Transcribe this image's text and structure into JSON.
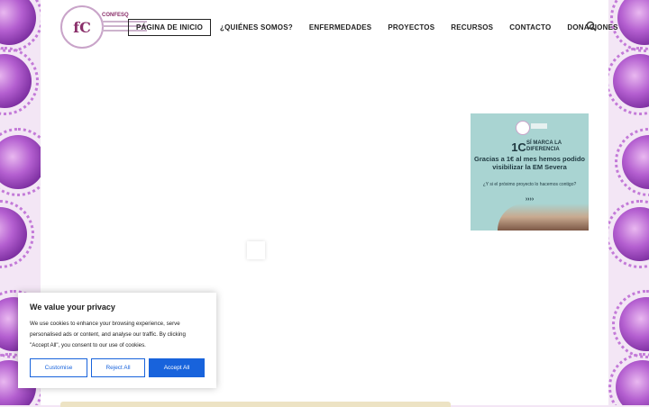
{
  "header": {
    "logo_mark": "fC",
    "logo_title": "CONFESQ",
    "nav": [
      {
        "label": "PÁGINA DE INICIO",
        "active": true
      },
      {
        "label": "¿QUIÉNES SOMOS?",
        "active": false
      },
      {
        "label": "ENFERMEDADES",
        "active": false
      },
      {
        "label": "PROYECTOS",
        "active": false
      },
      {
        "label": "RECURSOS",
        "active": false
      },
      {
        "label": "CONTACTO",
        "active": false
      },
      {
        "label": "DONACIONES",
        "active": false
      }
    ],
    "search_icon": "search-icon"
  },
  "ad": {
    "big": "1C",
    "small": "SÍ MARCA LA DIFERENCIA",
    "main": "Gracias a 1€ al mes hemos podido visibilizar la EM Severa",
    "sub": "¿Y si el próximo proyecto lo hacemos contigo?",
    "arrows": "››››",
    "bg_color": "#a9d4d2"
  },
  "cookie": {
    "title": "We value your privacy",
    "body": "We use cookies to enhance your browsing experience, serve personalised ads or content, and analyse our traffic. By clicking \"Accept All\", you consent to our use of cookies.",
    "customise": "Customise",
    "reject": "Reject All",
    "accept": "Accept All",
    "accent": "#1863dc"
  }
}
